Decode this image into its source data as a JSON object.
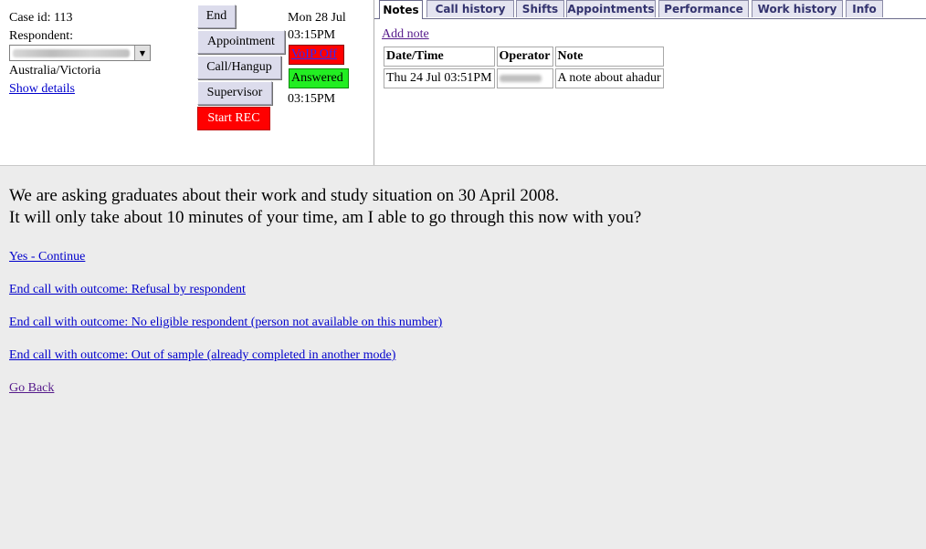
{
  "case": {
    "id_label": "Case id: 113",
    "respondent_label": "Respondent:",
    "region": "Australia/Victoria",
    "show_details": "Show details"
  },
  "controls": {
    "end": "End",
    "appointment": "Appointment",
    "call_hangup": "Call/Hangup",
    "supervisor": "Supervisor",
    "start_rec": "Start REC"
  },
  "time": {
    "date": "Mon 28 Jul",
    "time1": "03:15PM",
    "voip": "VoIP Off",
    "answered": "Answered",
    "time2": "03:15PM"
  },
  "tabs": [
    "Notes",
    "Call history",
    "Shifts",
    "Appointments",
    "Performance",
    "Work history",
    "Info"
  ],
  "notes": {
    "add_note": "Add note",
    "headers": [
      "Date/Time",
      "Operator",
      "Note"
    ],
    "rows": [
      {
        "datetime": "Thu 24 Jul 03:51PM",
        "note": "A note about ahadur"
      }
    ]
  },
  "main": {
    "question_line1": "We are asking graduates about their work and study situation on 30 April 2008.",
    "question_line2": "It will only take about 10 minutes of your time, am I able to go through this now with you?",
    "options": [
      "Yes - Continue",
      "End call with outcome: Refusal by respondent",
      "End call with outcome: No eligible respondent (person not available on this number)",
      "End call with outcome: Out of sample (already completed in another mode)"
    ],
    "go_back": "Go Back"
  },
  "colors": {
    "rec_button": "#ff0000",
    "voip_off": "#ff0000",
    "answered": "#22ee22",
    "link": "#0000cc",
    "visited_link": "#551a8b"
  }
}
